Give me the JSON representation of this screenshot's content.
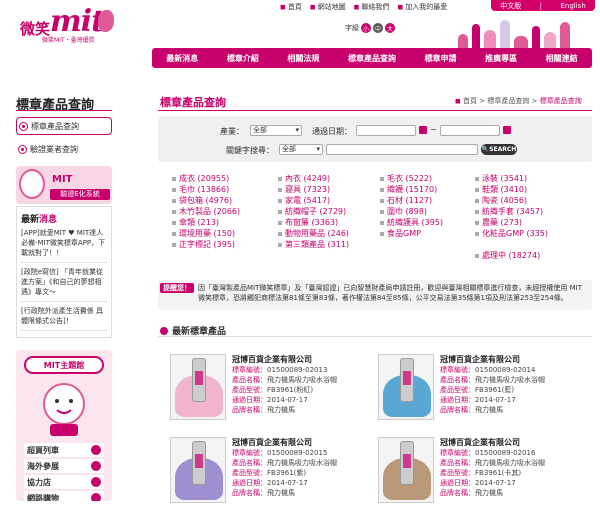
{
  "header": {
    "logo_text": "mit",
    "logo_wx": "微笑",
    "tagline": "微笑MIT・臺灣優質",
    "top_links": [
      {
        "icon": "home-icon",
        "label": "首頁"
      },
      {
        "icon": "sitemap-icon",
        "label": "網站地圖"
      },
      {
        "icon": "contact-icon",
        "label": "聯絡我們"
      },
      {
        "icon": "join-icon",
        "label": "加入我的最愛"
      }
    ],
    "lang": [
      "中文版",
      "English"
    ],
    "font_label": "字級",
    "font_sizes": [
      "小",
      "中",
      "大"
    ]
  },
  "nav": [
    "最新消息",
    "標章介紹",
    "相關法規",
    "標章產品查詢",
    "標章申請",
    "推廣專區",
    "相關連結"
  ],
  "sidebar": {
    "heading": "標章產品查詢",
    "menu": [
      "標章產品查詢",
      "驗證業者查詢"
    ],
    "ebanner_title": "MIT",
    "ebanner_sub": "驗證E化系統",
    "news_title_a": "最新",
    "news_title_b": "消息",
    "news": [
      "[APP]就愛MIT ♥ MIT達人必備-MIT微笑標章APP，下載就對了！！",
      "[政院e寫信] 「青年就業從進方案」《和自己的夢想相遇》專文～",
      "[行政院外派產生活費係 具體限條式公告]！"
    ],
    "theme_title": "MIT主題館",
    "theme_items": [
      "超買列車",
      "海外參展",
      "協力店",
      "網路購物"
    ]
  },
  "main": {
    "title": "標章產品查詢",
    "breadcrumb": [
      "首頁",
      "標章產品查詢",
      "標章產品查詢"
    ],
    "search": {
      "industry_label": "產業：",
      "industry_value": "全部",
      "date_label": "通過日期：",
      "date_sep": "~",
      "keyword_label": "關鍵字搜尋：",
      "keyword_scope": "全部",
      "button": "SEARCH"
    },
    "categories": [
      [
        "成衣 (20955)",
        "內衣 (4249)",
        "毛衣 (5222)",
        "泳裝 (3541)"
      ],
      [
        "毛巾 (13866)",
        "寢具 (7323)",
        "織襪 (15170)",
        "鞋類 (3410)"
      ],
      [
        "袋包箱 (4976)",
        "家電 (5417)",
        "石材 (1127)",
        "陶瓷 (4056)"
      ],
      [
        "木竹製品 (2066)",
        "紡織帽子 (2729)",
        "圍巾 (898)",
        "紡織手套 (3457)"
      ],
      [
        "傘類 (213)",
        "布窗簾 (3363)",
        "紡織護具 (395)",
        "農藥 (273)"
      ],
      [
        "環境用藥 (150)",
        "動物用藥品 (246)",
        "食品GMP",
        "化粧品GMP (335)"
      ],
      [
        "正字標記 (395)",
        "第三類產品 (311)",
        "",
        ""
      ],
      [
        "",
        "",
        "",
        "處理中 (18274)"
      ]
    ],
    "notice_badge": "提醒您！",
    "notice_text": "因「臺灣製產品MIT微笑標章」及「臺灣認證」已向智慧財產局申請註冊，歡迎與臺灣相關標章進行檢查，未經授權使用 MIT微笑標章，恐將觸犯商標法第81條至第83條，著作權法第84至85條，公平交易法第35條第1項及刑法第253至254條。",
    "new_products_title": "最新標章產品",
    "products": [
      {
        "company": "冠博百貨企業有限公司",
        "id": "01500089-02013",
        "name": "飛力機馬吸力吸水浴帽",
        "model": "FB3961(粉紅)",
        "date": "2014-07-17",
        "brand": "飛力機馬",
        "towel": "#f0b4cf"
      },
      {
        "company": "冠博百貨企業有限公司",
        "id": "01500089-02014",
        "name": "飛力機馬吸力吸水浴帽",
        "model": "FB3961(藍)",
        "date": "2014-07-17",
        "brand": "飛力機馬",
        "towel": "#5aa7d6"
      },
      {
        "company": "冠博百貨企業有限公司",
        "id": "01500089-02015",
        "name": "飛力機馬吸力吸水浴帽",
        "model": "FB3961(紫)",
        "date": "2014-07-17",
        "brand": "飛力機馬",
        "towel": "#9f8fd0"
      },
      {
        "company": "冠博百貨企業有限公司",
        "id": "01500089-02016",
        "name": "飛力機馬吸力吸水浴帽",
        "model": "FB3961(卡其)",
        "date": "2014-07-17",
        "brand": "飛力機馬",
        "towel": "#b89a78"
      }
    ],
    "labels": {
      "id": "標章編號：",
      "name": "產品名稱：",
      "model": "產品型號：",
      "date": "通過日期：",
      "brand": "品牌名稱："
    }
  },
  "colors": {
    "accent": "#c8006b"
  }
}
